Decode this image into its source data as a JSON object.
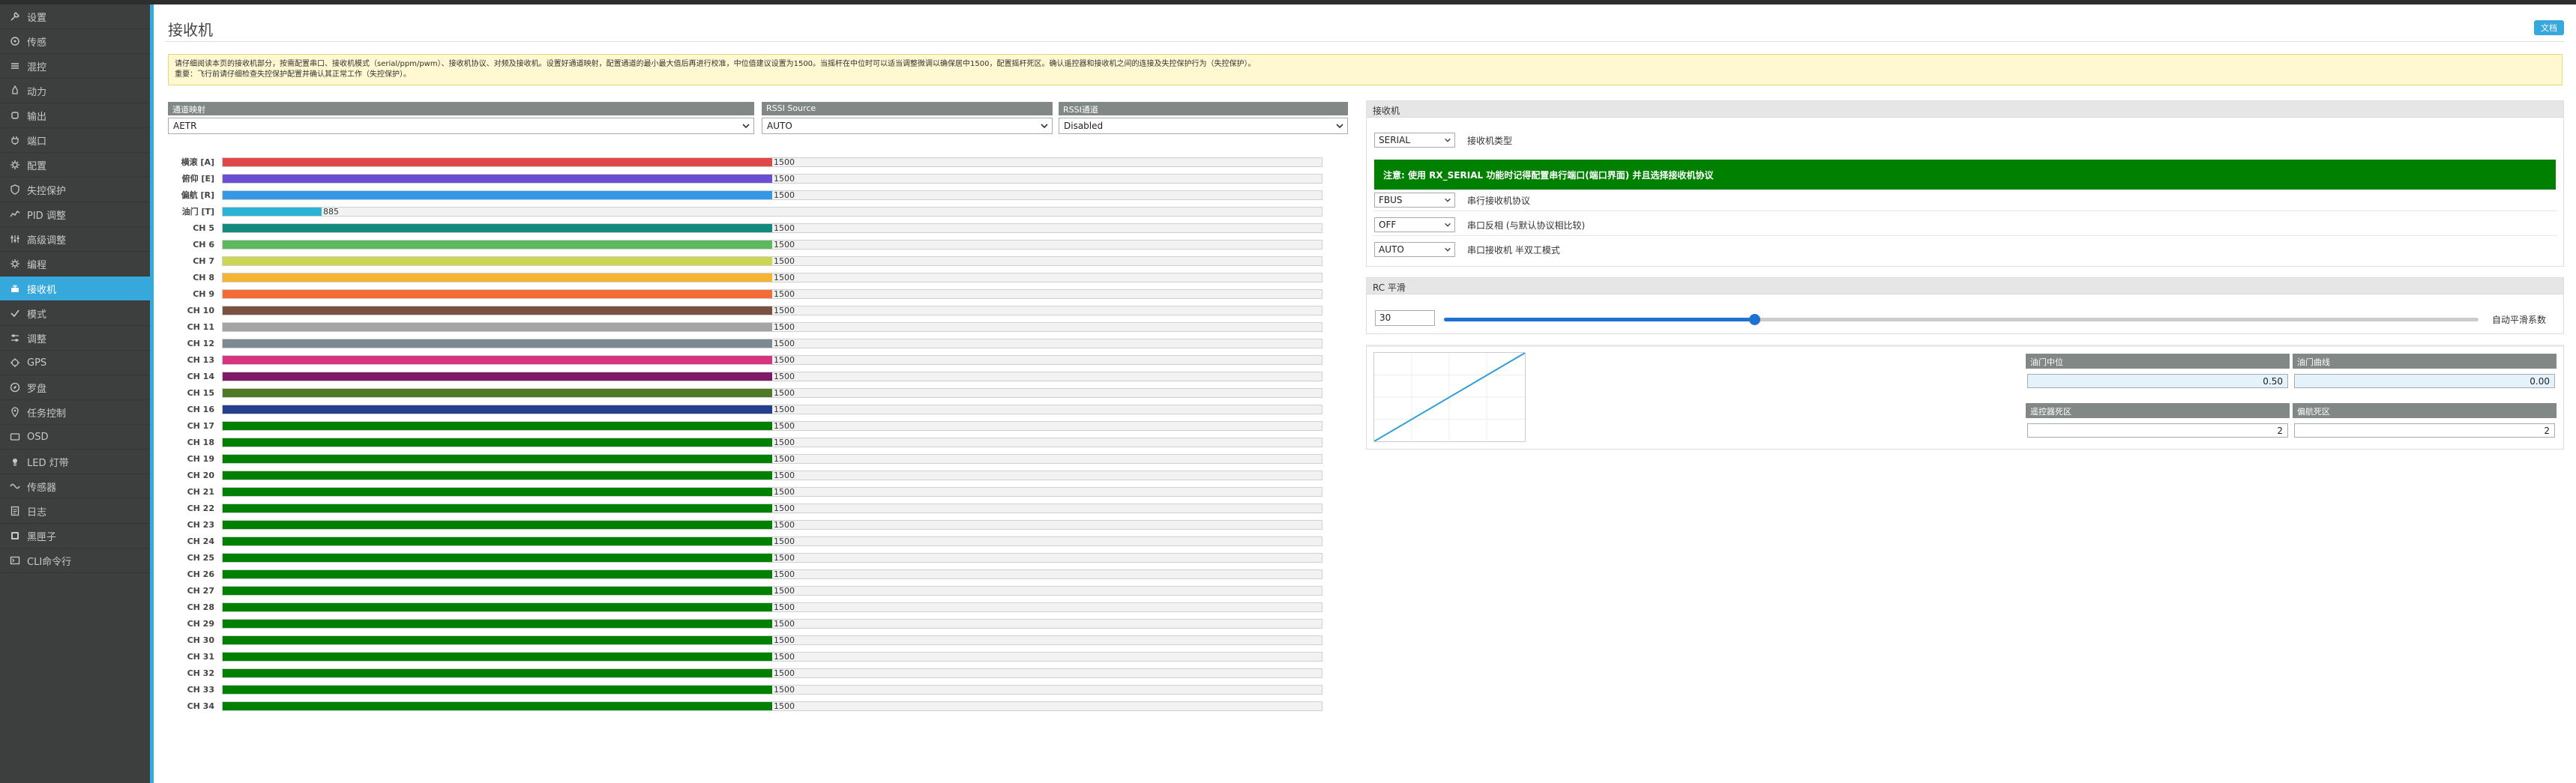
{
  "sidebar": {
    "items": [
      {
        "label": "设置",
        "icon": "wrench-icon"
      },
      {
        "label": "传感",
        "icon": "sensor-icon"
      },
      {
        "label": "混控",
        "icon": "mixer-icon"
      },
      {
        "label": "动力",
        "icon": "rocket-icon"
      },
      {
        "label": "输出",
        "icon": "motor-icon"
      },
      {
        "label": "端口",
        "icon": "plug-icon"
      },
      {
        "label": "配置",
        "icon": "gear-icon"
      },
      {
        "label": "失控保护",
        "icon": "shield-icon"
      },
      {
        "label": "PID 调整",
        "icon": "pid-icon"
      },
      {
        "label": "高级调整",
        "icon": "tune-icon"
      },
      {
        "label": "编程",
        "icon": "gear-icon"
      },
      {
        "label": "接收机",
        "icon": "receiver-icon"
      },
      {
        "label": "模式",
        "icon": "modes-icon"
      },
      {
        "label": "调整",
        "icon": "adjust-icon"
      },
      {
        "label": "GPS",
        "icon": "gps-icon"
      },
      {
        "label": "罗盘",
        "icon": "compass-icon"
      },
      {
        "label": "任务控制",
        "icon": "map-pin-icon"
      },
      {
        "label": "OSD",
        "icon": "osd-icon"
      },
      {
        "label": "LED 灯带",
        "icon": "led-icon"
      },
      {
        "label": "传感器",
        "icon": "sensors-icon"
      },
      {
        "label": "日志",
        "icon": "log-icon"
      },
      {
        "label": "黑匣子",
        "icon": "blackbox-icon"
      },
      {
        "label": "CLI命令行",
        "icon": "terminal-icon"
      }
    ],
    "active_index": 11
  },
  "header": {
    "title": "接收机",
    "doc_button": "文档"
  },
  "notice": {
    "line1": "请仔细阅读本页的接收机部分，按需配置串口、接收机模式（serial/ppm/pwm）、接收机协议、对频及接收机。设置好通道映射，配置通道的最小最大值后再进行校准，中位值建议设置为1500。当摇杆在中位时可以适当调整微调以确保居中1500，配置摇杆死区。确认遥控器和接收机之间的连接及失控保护行为（失控保护）。",
    "line2": "重要：飞行前请仔细检查失控保护配置并确认其正常工作（失控保护）。"
  },
  "channel_map": {
    "head": "通道映射",
    "value": "AETR"
  },
  "rssi_source": {
    "head": "RSSI Source",
    "value": "AUTO"
  },
  "rssi_channel": {
    "head": "RSSI通道",
    "value": "Disabled"
  },
  "channels": [
    {
      "label": "横滚 [A]",
      "value": 1500,
      "color": "#e04848"
    },
    {
      "label": "俯仰 [E]",
      "value": 1500,
      "color": "#6a4fd4"
    },
    {
      "label": "偏航 [R]",
      "value": 1500,
      "color": "#3498e6"
    },
    {
      "label": "油门 [T]",
      "value": 885,
      "color": "#2bb3d6"
    },
    {
      "label": "CH 5",
      "value": 1500,
      "color": "#138a7c"
    },
    {
      "label": "CH 6",
      "value": 1500,
      "color": "#5cb85c"
    },
    {
      "label": "CH 7",
      "value": 1500,
      "color": "#cdd653"
    },
    {
      "label": "CH 8",
      "value": 1500,
      "color": "#f4b632"
    },
    {
      "label": "CH 9",
      "value": 1500,
      "color": "#f36b36"
    },
    {
      "label": "CH 10",
      "value": 1500,
      "color": "#7b5241"
    },
    {
      "label": "CH 11",
      "value": 1500,
      "color": "#a4a4a4"
    },
    {
      "label": "CH 12",
      "value": 1500,
      "color": "#7d8a92"
    },
    {
      "label": "CH 13",
      "value": 1500,
      "color": "#d63480"
    },
    {
      "label": "CH 14",
      "value": 1500,
      "color": "#7e1a68"
    },
    {
      "label": "CH 15",
      "value": 1500,
      "color": "#4e7a23"
    },
    {
      "label": "CH 16",
      "value": 1500,
      "color": "#253f8c"
    },
    {
      "label": "CH 17",
      "value": 1500,
      "color": "#008000"
    },
    {
      "label": "CH 18",
      "value": 1500,
      "color": "#008000"
    },
    {
      "label": "CH 19",
      "value": 1500,
      "color": "#008000"
    },
    {
      "label": "CH 20",
      "value": 1500,
      "color": "#008000"
    },
    {
      "label": "CH 21",
      "value": 1500,
      "color": "#008000"
    },
    {
      "label": "CH 22",
      "value": 1500,
      "color": "#008000"
    },
    {
      "label": "CH 23",
      "value": 1500,
      "color": "#008000"
    },
    {
      "label": "CH 24",
      "value": 1500,
      "color": "#008000"
    },
    {
      "label": "CH 25",
      "value": 1500,
      "color": "#008000"
    },
    {
      "label": "CH 26",
      "value": 1500,
      "color": "#008000"
    },
    {
      "label": "CH 27",
      "value": 1500,
      "color": "#008000"
    },
    {
      "label": "CH 28",
      "value": 1500,
      "color": "#008000"
    },
    {
      "label": "CH 29",
      "value": 1500,
      "color": "#008000"
    },
    {
      "label": "CH 30",
      "value": 1500,
      "color": "#008000"
    },
    {
      "label": "CH 31",
      "value": 1500,
      "color": "#008000"
    },
    {
      "label": "CH 32",
      "value": 1500,
      "color": "#008000"
    },
    {
      "label": "CH 33",
      "value": 1500,
      "color": "#008000"
    },
    {
      "label": "CH 34",
      "value": 1500,
      "color": "#008000"
    }
  ],
  "channel_range": {
    "min": 750,
    "max": 2250
  },
  "receiver_panel": {
    "head": "接收机",
    "type_value": "SERIAL",
    "type_label": "接收机类型",
    "note": "注意: 使用 RX_SERIAL 功能时记得配置串行端口(端口界面) 并且选择接收机协议",
    "protocol_value": "FBUS",
    "protocol_label": "串行接收机协议",
    "inverted_value": "OFF",
    "inverted_label": "串口反相 (与默认协议相比较)",
    "halfduplex_value": "AUTO",
    "halfduplex_label": "串口接收机 半双工模式"
  },
  "rc_smoothing": {
    "head": "RC 平滑",
    "value": "30",
    "label": "自动平滑系数",
    "slider_fraction": 0.3
  },
  "throttle": {
    "mid_head": "油门中位",
    "mid_value": "0.50",
    "expo_head": "油门曲线",
    "expo_value": "0.00",
    "deadband_head": "遥控器死区",
    "deadband_value": "2",
    "yaw_deadband_head": "偏航死区",
    "yaw_deadband_value": "2"
  },
  "colors": {
    "accent": "#37a8db",
    "sidebar_bg": "#3d3f3e",
    "note_green": "#008000",
    "header_grey": "#828885"
  }
}
